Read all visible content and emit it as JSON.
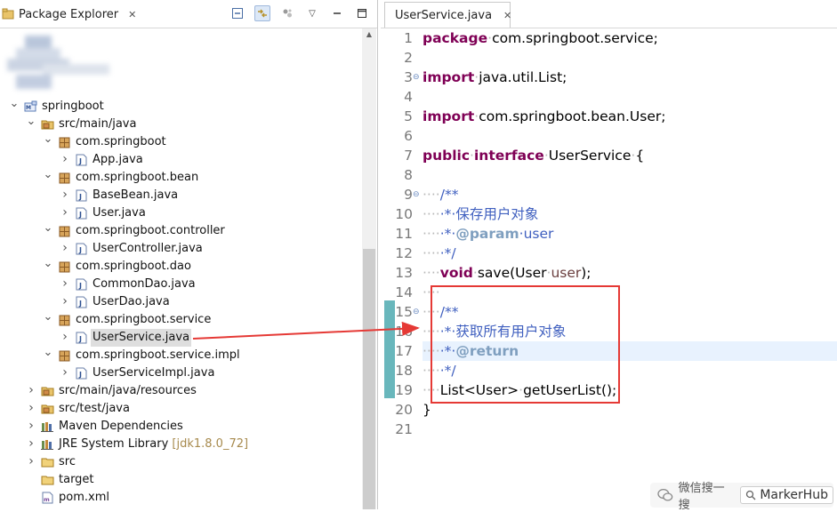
{
  "explorer": {
    "tab_label": "Package Explorer",
    "tree": [
      {
        "label": "springboot",
        "extra": "",
        "level": 0,
        "expanded": true,
        "icon": "project-icon",
        "selected": false
      },
      {
        "label": "src/main/java",
        "extra": "",
        "level": 1,
        "expanded": true,
        "icon": "source-folder-icon",
        "selected": false
      },
      {
        "label": "com.springboot",
        "extra": "",
        "level": 2,
        "expanded": true,
        "icon": "package-icon",
        "selected": false
      },
      {
        "label": "App.java",
        "extra": "",
        "level": 3,
        "expanded": false,
        "icon": "java-file-icon",
        "selected": false
      },
      {
        "label": "com.springboot.bean",
        "extra": "",
        "level": 2,
        "expanded": true,
        "icon": "package-icon",
        "selected": false
      },
      {
        "label": "BaseBean.java",
        "extra": "",
        "level": 3,
        "expanded": false,
        "icon": "java-file-icon",
        "selected": false
      },
      {
        "label": "User.java",
        "extra": "",
        "level": 3,
        "expanded": false,
        "icon": "java-file-icon",
        "selected": false
      },
      {
        "label": "com.springboot.controller",
        "extra": "",
        "level": 2,
        "expanded": true,
        "icon": "package-icon",
        "selected": false
      },
      {
        "label": "UserController.java",
        "extra": "",
        "level": 3,
        "expanded": false,
        "icon": "java-file-icon",
        "selected": false
      },
      {
        "label": "com.springboot.dao",
        "extra": "",
        "level": 2,
        "expanded": true,
        "icon": "package-icon",
        "selected": false
      },
      {
        "label": "CommonDao.java",
        "extra": "",
        "level": 3,
        "expanded": false,
        "icon": "java-file-icon",
        "selected": false
      },
      {
        "label": "UserDao.java",
        "extra": "",
        "level": 3,
        "expanded": false,
        "icon": "java-file-icon",
        "selected": false
      },
      {
        "label": "com.springboot.service",
        "extra": "",
        "level": 2,
        "expanded": true,
        "icon": "package-icon",
        "selected": false
      },
      {
        "label": "UserService.java",
        "extra": "",
        "level": 3,
        "expanded": false,
        "icon": "java-file-icon",
        "selected": true
      },
      {
        "label": "com.springboot.service.impl",
        "extra": "",
        "level": 2,
        "expanded": true,
        "icon": "package-icon",
        "selected": false
      },
      {
        "label": "UserServiceImpl.java",
        "extra": "",
        "level": 3,
        "expanded": false,
        "icon": "java-file-icon",
        "selected": false
      },
      {
        "label": "src/main/java/resources",
        "extra": "",
        "level": 1,
        "expanded": false,
        "icon": "source-folder-icon",
        "selected": false
      },
      {
        "label": "src/test/java",
        "extra": "",
        "level": 1,
        "expanded": false,
        "icon": "source-folder-icon",
        "selected": false
      },
      {
        "label": "Maven Dependencies",
        "extra": "",
        "level": 1,
        "expanded": false,
        "icon": "library-icon",
        "selected": false
      },
      {
        "label": "JRE System Library",
        "extra": "[jdk1.8.0_72]",
        "level": 1,
        "expanded": false,
        "icon": "library-icon",
        "selected": false
      },
      {
        "label": "src",
        "extra": "",
        "level": 1,
        "expanded": false,
        "icon": "folder-icon",
        "selected": false
      },
      {
        "label": "target",
        "extra": "",
        "level": 1,
        "expanded": null,
        "icon": "folder-icon",
        "selected": false
      },
      {
        "label": "pom.xml",
        "extra": "",
        "level": 1,
        "expanded": null,
        "icon": "xml-file-icon",
        "selected": false
      }
    ]
  },
  "editor": {
    "tab_label": "UserService.java",
    "lines": [
      {
        "n": "1",
        "tokens": [
          [
            "kw",
            "package"
          ],
          [
            "dot",
            "·"
          ],
          [
            "",
            "com.springboot.service;"
          ]
        ]
      },
      {
        "n": "2",
        "tokens": []
      },
      {
        "n": "3",
        "fold": true,
        "tokens": [
          [
            "kw",
            "import"
          ],
          [
            "dot",
            "·"
          ],
          [
            "",
            "java.util.List;"
          ]
        ]
      },
      {
        "n": "4",
        "tokens": []
      },
      {
        "n": "5",
        "tokens": [
          [
            "kw",
            "import"
          ],
          [
            "dot",
            "·"
          ],
          [
            "",
            "com.springboot.bean.User;"
          ]
        ]
      },
      {
        "n": "6",
        "tokens": []
      },
      {
        "n": "7",
        "tokens": [
          [
            "kw",
            "public"
          ],
          [
            "dot",
            "·"
          ],
          [
            "kw",
            "interface"
          ],
          [
            "dot",
            "·"
          ],
          [
            "",
            "UserService"
          ],
          [
            "dot",
            "·"
          ],
          [
            "",
            "{"
          ]
        ]
      },
      {
        "n": "8",
        "tokens": []
      },
      {
        "n": "9",
        "fold": true,
        "tokens": [
          [
            "dot",
            "····"
          ],
          [
            "cm",
            "/**"
          ]
        ]
      },
      {
        "n": "10",
        "tokens": [
          [
            "dot",
            "····"
          ],
          [
            "cm",
            "·*·保存用户对象"
          ]
        ]
      },
      {
        "n": "11",
        "tokens": [
          [
            "dot",
            "····"
          ],
          [
            "cm",
            "·*·"
          ],
          [
            "tag",
            "@param"
          ],
          [
            "cm",
            "·user"
          ]
        ]
      },
      {
        "n": "12",
        "tokens": [
          [
            "dot",
            "····"
          ],
          [
            "cm",
            "·*/"
          ]
        ]
      },
      {
        "n": "13",
        "tokens": [
          [
            "dot",
            "····"
          ],
          [
            "kw",
            "void"
          ],
          [
            "dot",
            "·"
          ],
          [
            "",
            "save(User"
          ],
          [
            "dot",
            "·"
          ],
          [
            "pr",
            "user"
          ],
          [
            "",
            "); "
          ]
        ]
      },
      {
        "n": "14",
        "tokens": [
          [
            "dot",
            "····"
          ]
        ]
      },
      {
        "n": "15",
        "fold": true,
        "tokens": [
          [
            "dot",
            "····"
          ],
          [
            "cm",
            "/**"
          ]
        ]
      },
      {
        "n": "16",
        "tokens": [
          [
            "dot",
            "····"
          ],
          [
            "cm",
            "·*·获取所有用户对象"
          ]
        ]
      },
      {
        "n": "17",
        "hl": true,
        "tokens": [
          [
            "dot",
            "····"
          ],
          [
            "cm",
            "·*·"
          ],
          [
            "tag",
            "@return"
          ]
        ]
      },
      {
        "n": "18",
        "tokens": [
          [
            "dot",
            "····"
          ],
          [
            "cm",
            "·*/"
          ]
        ]
      },
      {
        "n": "19",
        "tokens": [
          [
            "dot",
            "····"
          ],
          [
            "",
            "List<User>"
          ],
          [
            "dot",
            "·"
          ],
          [
            "",
            "getUserList();"
          ]
        ]
      },
      {
        "n": "20",
        "tokens": [
          [
            "",
            "}"
          ]
        ]
      },
      {
        "n": "21",
        "tokens": []
      }
    ]
  },
  "watermark": {
    "prefix": "微信搜一搜",
    "name": "MarkerHub"
  },
  "colors": {
    "keyword": "#7f0055",
    "comment": "#3f5fbf",
    "javadoc_tag": "#7f9fbf",
    "annotation_red": "#e53935",
    "quick_diff": "#69b7bc"
  }
}
